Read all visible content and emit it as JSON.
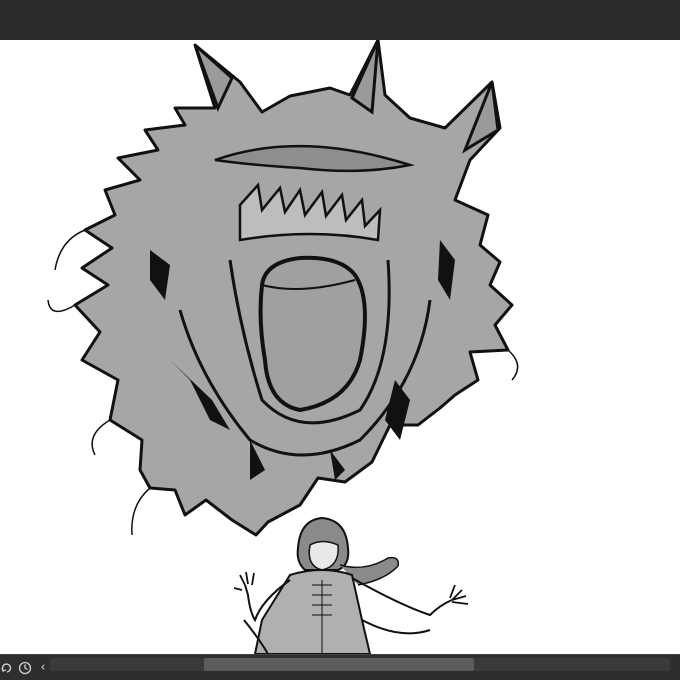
{
  "app": {
    "title": ""
  },
  "canvas": {
    "background": "#ffffff",
    "fill_color": "#a6a6a6",
    "ink_color": "#111111",
    "content": "monster-and-girl-illustration"
  },
  "bottom_bar": {
    "rotate_icon": "rotate-icon",
    "history_icon": "clock-history-icon",
    "scroll_left_icon": "chevron-left-icon",
    "scroll_left_glyph": "‹",
    "scrollbar_position": 0.44
  },
  "colors": {
    "chrome": "#2b2b2b",
    "scroll_track": "#3a3a3a",
    "scroll_thumb": "#5c5c5c"
  }
}
